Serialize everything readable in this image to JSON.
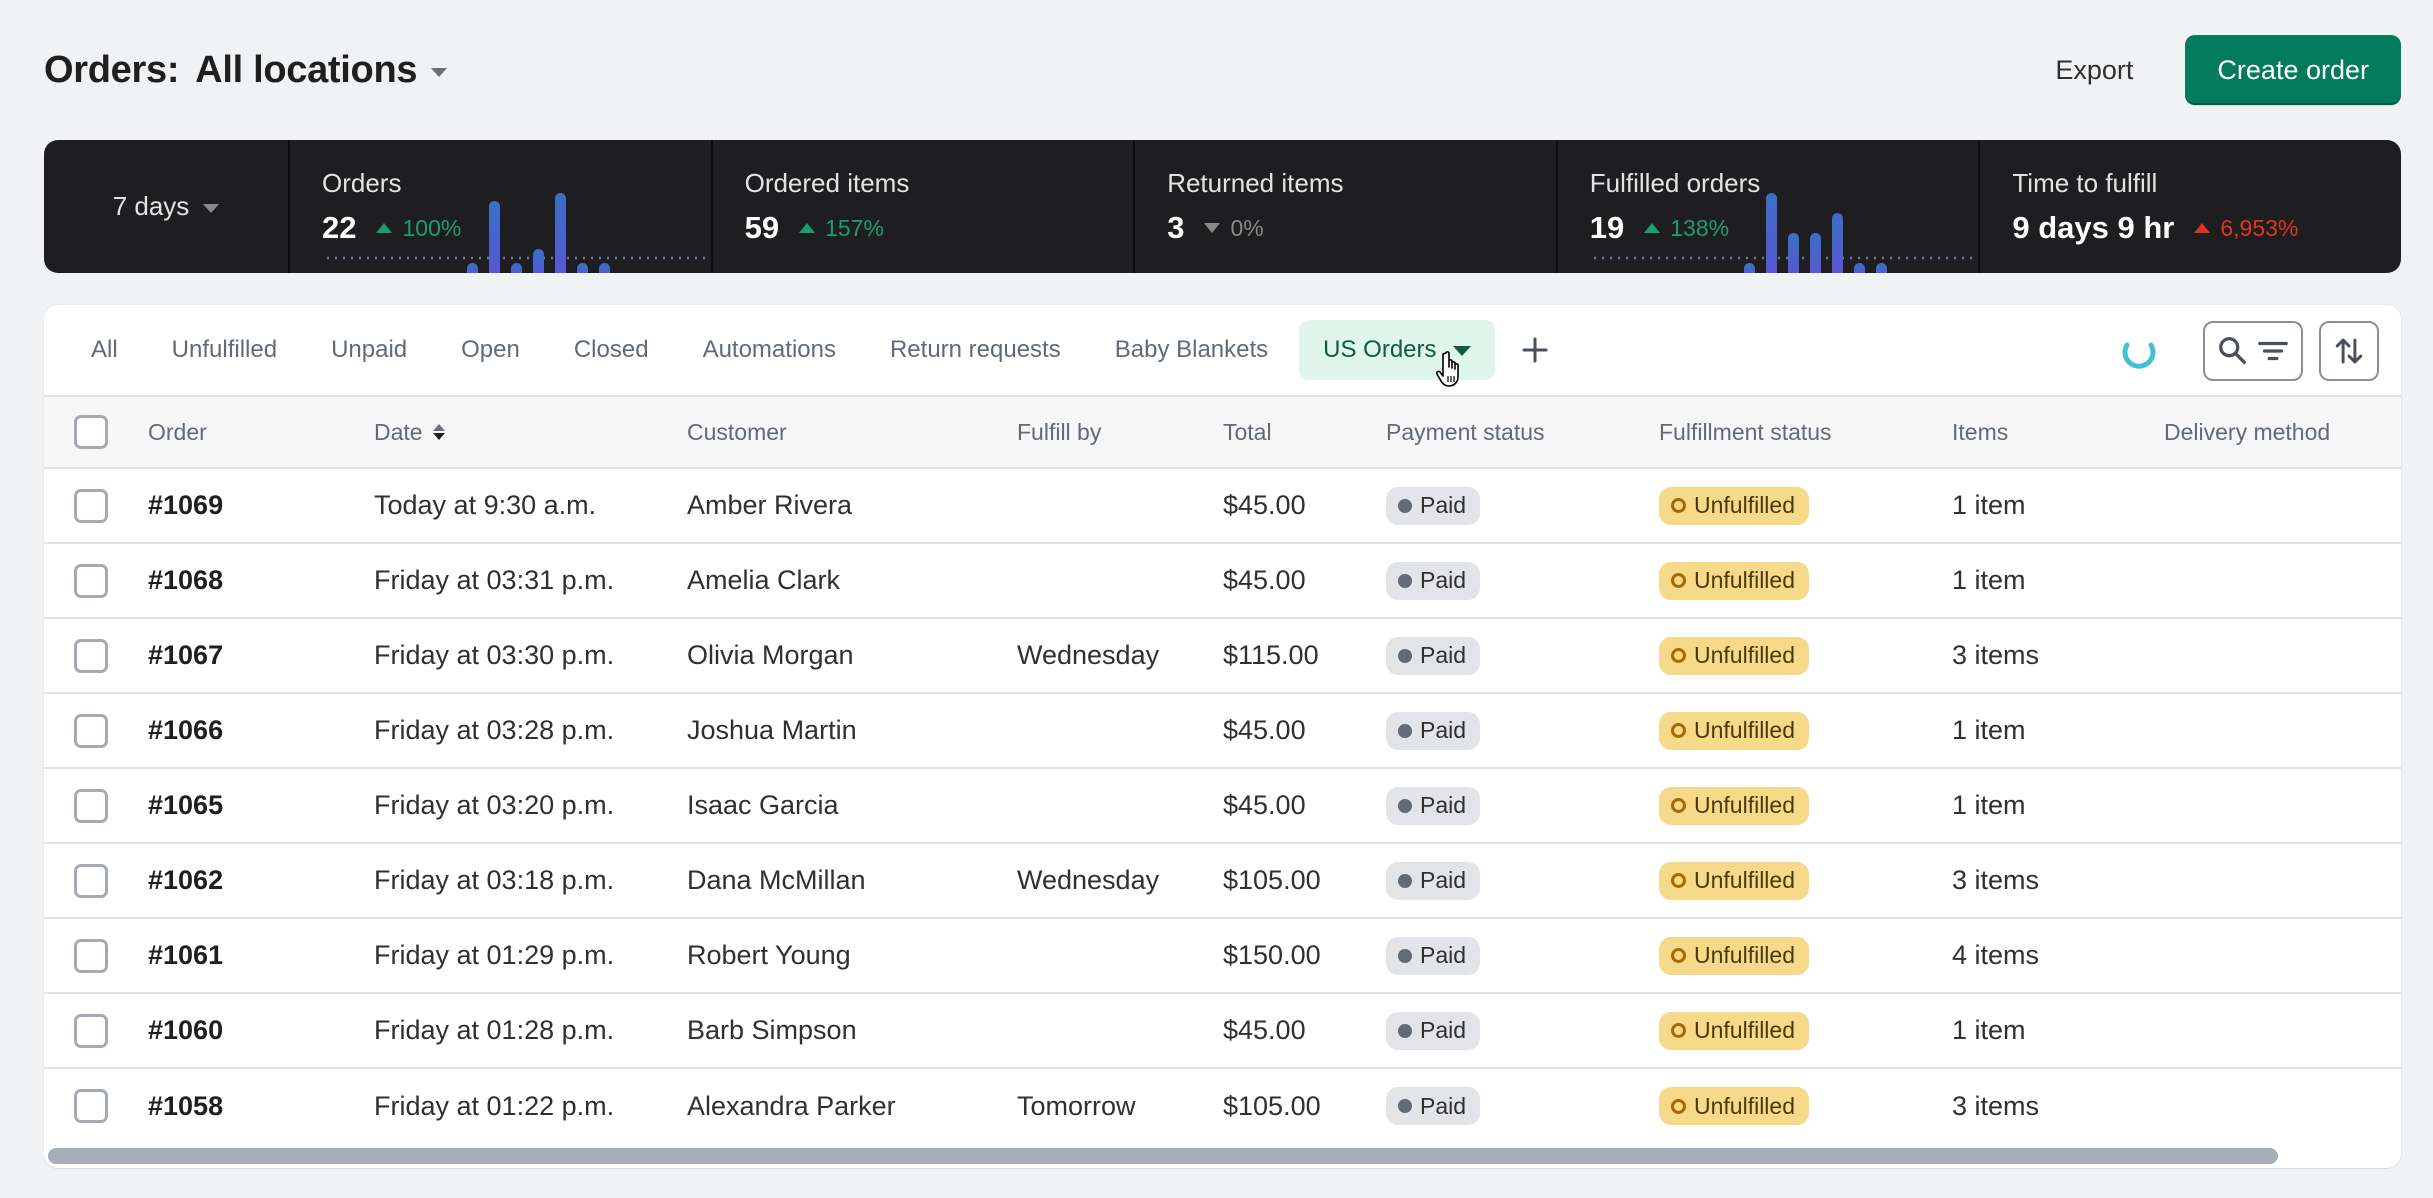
{
  "header": {
    "title": "Orders:",
    "location": "All locations",
    "export_label": "Export",
    "create_label": "Create order"
  },
  "metrics": {
    "period": "7 days",
    "cards": [
      {
        "label": "Orders",
        "value": "22",
        "delta": "100%",
        "direction": "up",
        "sentiment": "positive",
        "sparkline": [
          0.1,
          0.9,
          0.1,
          0.3,
          1.0,
          0.1,
          0.1
        ]
      },
      {
        "label": "Ordered items",
        "value": "59",
        "delta": "157%",
        "direction": "up",
        "sentiment": "positive"
      },
      {
        "label": "Returned items",
        "value": "3",
        "delta": "0%",
        "direction": "down",
        "sentiment": "neutral"
      },
      {
        "label": "Fulfilled orders",
        "value": "19",
        "delta": "138%",
        "direction": "up",
        "sentiment": "positive",
        "sparkline": [
          0.1,
          1.0,
          0.5,
          0.5,
          0.75,
          0.1,
          0.1
        ]
      },
      {
        "label": "Time to fulfill",
        "value": "9 days 9 hr",
        "delta": "6,953%",
        "direction": "up",
        "sentiment": "negative"
      }
    ],
    "colors": {
      "positive": "#1a9e6f",
      "neutral": "#8a8a8a",
      "negative": "#e0341f",
      "bar": "#4f5fd0"
    }
  },
  "tabs": {
    "items": [
      "All",
      "Unfulfilled",
      "Unpaid",
      "Open",
      "Closed",
      "Automations",
      "Return requests",
      "Baby Blankets"
    ],
    "active": "US Orders",
    "add_icon": "plus-icon",
    "loading_icon": "spinner-icon",
    "search_filter_icon": "search-filter-icon",
    "sort_icon": "sort-arrows-icon"
  },
  "table": {
    "columns": [
      "Order",
      "Date",
      "Customer",
      "Fulfill by",
      "Total",
      "Payment status",
      "Fulfillment status",
      "Items",
      "Delivery method"
    ],
    "rows": [
      {
        "order": "#1069",
        "date": "Today at 9:30 a.m.",
        "customer": "Amber Rivera",
        "fulfill_by": "",
        "total": "$45.00",
        "payment": "Paid",
        "fulfillment": "Unfulfilled",
        "items": "1 item",
        "delivery": ""
      },
      {
        "order": "#1068",
        "date": "Friday at 03:31 p.m.",
        "customer": "Amelia Clark",
        "fulfill_by": "",
        "total": "$45.00",
        "payment": "Paid",
        "fulfillment": "Unfulfilled",
        "items": "1 item",
        "delivery": ""
      },
      {
        "order": "#1067",
        "date": "Friday at 03:30 p.m.",
        "customer": "Olivia Morgan",
        "fulfill_by": "Wednesday",
        "total": "$115.00",
        "payment": "Paid",
        "fulfillment": "Unfulfilled",
        "items": "3 items",
        "delivery": ""
      },
      {
        "order": "#1066",
        "date": "Friday at 03:28 p.m.",
        "customer": "Joshua Martin",
        "fulfill_by": "",
        "total": "$45.00",
        "payment": "Paid",
        "fulfillment": "Unfulfilled",
        "items": "1 item",
        "delivery": ""
      },
      {
        "order": "#1065",
        "date": "Friday at 03:20 p.m.",
        "customer": "Isaac Garcia",
        "fulfill_by": "",
        "total": "$45.00",
        "payment": "Paid",
        "fulfillment": "Unfulfilled",
        "items": "1 item",
        "delivery": ""
      },
      {
        "order": "#1062",
        "date": "Friday at 03:18 p.m.",
        "customer": "Dana McMillan",
        "fulfill_by": "Wednesday",
        "total": "$105.00",
        "payment": "Paid",
        "fulfillment": "Unfulfilled",
        "items": "3 items",
        "delivery": ""
      },
      {
        "order": "#1061",
        "date": "Friday at 01:29 p.m.",
        "customer": "Robert Young",
        "fulfill_by": "",
        "total": "$150.00",
        "payment": "Paid",
        "fulfillment": "Unfulfilled",
        "items": "4 items",
        "delivery": ""
      },
      {
        "order": "#1060",
        "date": "Friday at 01:28 p.m.",
        "customer": "Barb Simpson",
        "fulfill_by": "",
        "total": "$45.00",
        "payment": "Paid",
        "fulfillment": "Unfulfilled",
        "items": "1 item",
        "delivery": ""
      },
      {
        "order": "#1058",
        "date": "Friday at 01:22 p.m.",
        "customer": "Alexandra Parker",
        "fulfill_by": "Tomorrow",
        "total": "$105.00",
        "payment": "Paid",
        "fulfillment": "Unfulfilled",
        "items": "3 items",
        "delivery": ""
      }
    ]
  },
  "colors": {
    "primary": "#047b5d",
    "active_tab_bg": "#e0f5ec",
    "active_tab_text": "#0f5c43",
    "paid_badge": "#e3e4e7",
    "unfulfilled_badge": "#f7d98a",
    "spinner": "#3fc1d6"
  }
}
